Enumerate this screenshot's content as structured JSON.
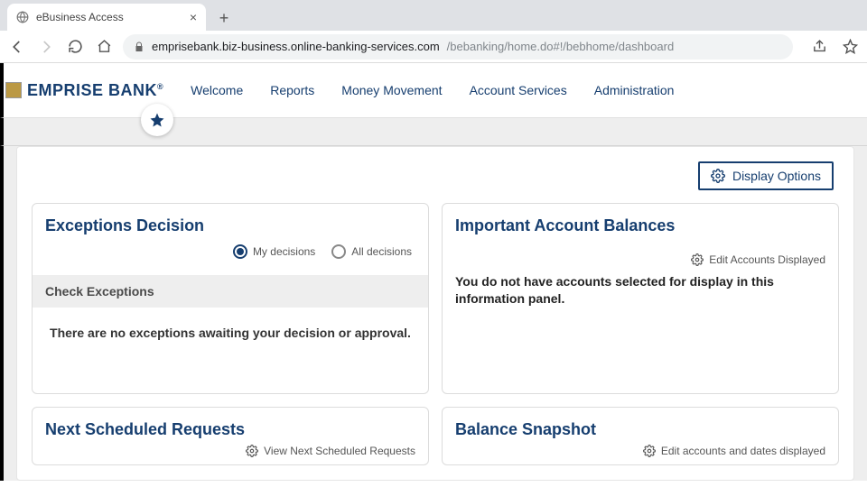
{
  "browser": {
    "tab_title": "eBusiness Access",
    "url_main": "emprisebank.biz-business.online-banking-services.com",
    "url_sub": "/bebanking/home.do#!/bebhome/dashboard"
  },
  "logo_text": "EMPRISE BANK",
  "nav": {
    "items": [
      "Welcome",
      "Reports",
      "Money Movement",
      "Account Services",
      "Administration"
    ]
  },
  "top_actions": {
    "display_options": "Display Options"
  },
  "exceptions": {
    "title": "Exceptions Decision",
    "radio_my": "My decisions",
    "radio_all": "All decisions",
    "band_label": "Check Exceptions",
    "empty_msg": "There are no exceptions awaiting your decision or approval."
  },
  "balances": {
    "title": "Important Account Balances",
    "edit_link": "Edit Accounts Displayed",
    "empty_msg": "You do not have accounts selected for display in this information panel."
  },
  "next_requests": {
    "title": "Next Scheduled Requests",
    "link": "View Next Scheduled Requests"
  },
  "balance_snapshot": {
    "title": "Balance Snapshot",
    "link": "Edit accounts and dates displayed"
  }
}
